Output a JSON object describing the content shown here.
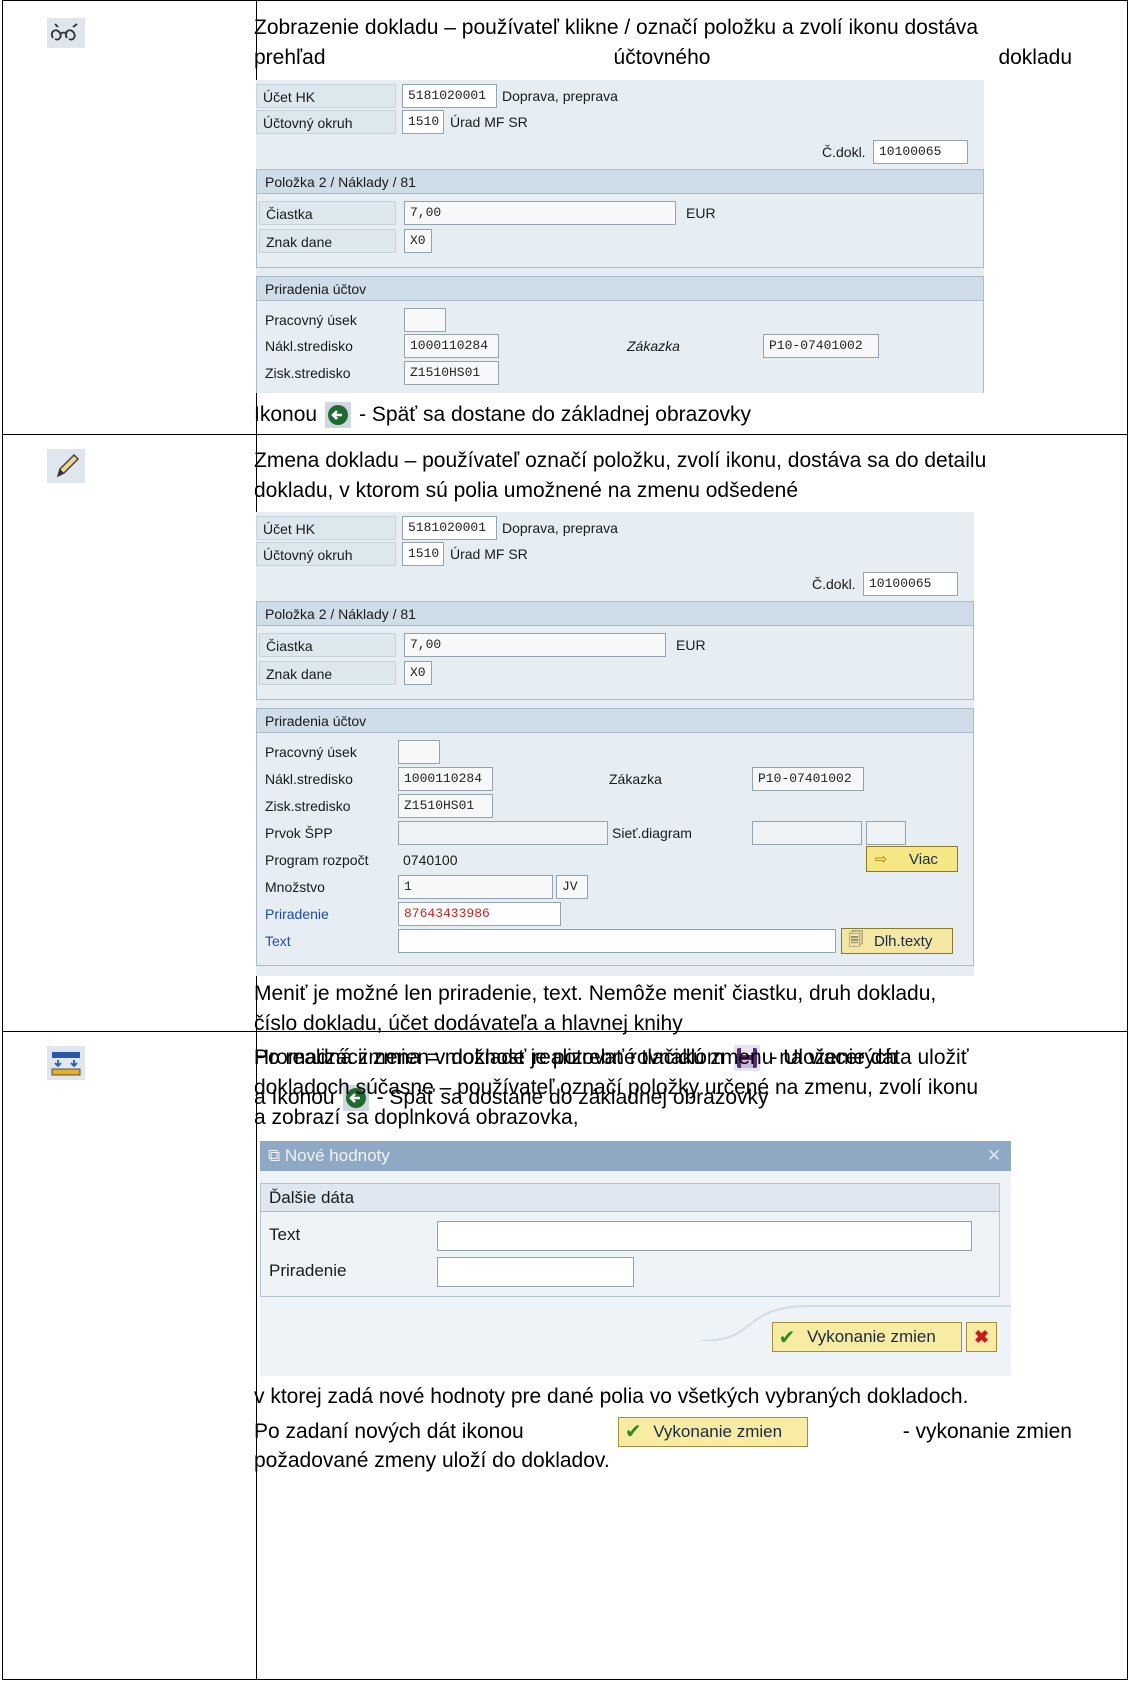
{
  "row1": {
    "icon": "glasses-icon",
    "desc_lines": [
      "Zobrazenie dokladu – používateľ klikne / označí položku a zvolí ikonu dostáva",
      "prehľad účtovného dokladu"
    ],
    "screen": {
      "ucet_hk_label": "Účet HK",
      "ucet_hk_value": "5181020001",
      "ucet_hk_desc": "Doprava, preprava",
      "okruh_label": "Účtovný okruh",
      "okruh_value": "1510",
      "okruh_desc": "Úrad MF SR",
      "cdokl_label": "Č.dokl.",
      "cdokl_value": "10100065",
      "polozka_title": "Položka 2 / Náklady / 81",
      "ciastka_label": "Čiastka",
      "ciastka_value": "7,00",
      "currency": "EUR",
      "znak_label": "Znak dane",
      "znak_value": "X0",
      "priradenia_title": "Priradenia účtov",
      "pracovny_label": "Pracovný úsek",
      "nakl_label": "Nákl.stredisko",
      "nakl_value": "1000110284",
      "zakazka_label": "Zákazka",
      "zakazka_value": "P10-07401002",
      "zisk_label": "Zisk.stredisko",
      "zisk_value": "Z1510HS01"
    },
    "footer_prefix": "Ikonou",
    "footer_suffix": "- Späť sa dostane do základnej obrazovky"
  },
  "row2": {
    "icon": "pencil-icon",
    "desc_lines": [
      "Zmena dokladu – používateľ označí položku, zvolí ikonu, dostáva sa do detailu",
      "dokladu, v ktorom sú polia umožnené na zmenu odšedené"
    ],
    "screen": {
      "ucet_hk_label": "Účet HK",
      "ucet_hk_value": "5181020001",
      "ucet_hk_desc": "Doprava, preprava",
      "okruh_label": "Účtovný okruh",
      "okruh_value": "1510",
      "okruh_desc": "Úrad MF SR",
      "cdokl_label": "Č.dokl.",
      "cdokl_value": "10100065",
      "polozka_title": "Položka 2 / Náklady / 81",
      "ciastka_label": "Čiastka",
      "ciastka_value": "7,00",
      "currency": "EUR",
      "znak_label": "Znak dane",
      "znak_value": "X0",
      "priradenia_title": "Priradenia účtov",
      "pracovny_label": "Pracovný úsek",
      "nakl_label": "Nákl.stredisko",
      "nakl_value": "1000110284",
      "zakazka_label": "Zákazka",
      "zakazka_value": "P10-07401002",
      "zisk_label": "Zisk.stredisko",
      "zisk_value": "Z1510HS01",
      "prvok_label": "Prvok ŠPP",
      "siet_label": "Sieť.diagram",
      "program_label": "Program rozpočt",
      "program_value": "0740100",
      "viac_label": "Viac",
      "mnozstvo_label": "Množstvo",
      "mnozstvo_value": "1",
      "unit_value": "JV",
      "priradenie_label": "Priradenie",
      "priradenie_value": "87643433986",
      "text_label": "Text",
      "dlh_label": "Dlh.texty"
    },
    "para1_lines": [
      "Meniť je možné len priradenie, text. Nemôže meniť čiastku, druh dokladu,",
      "číslo dokladu, účet dodávateľa a hlavnej knihy"
    ],
    "para2_prefix": "Po realizácii zmien v doklade je potrebné tlačidlom",
    "para2_suffix": "- Uloženie dáta uložiť",
    "para3_prefix": "a Ikonou",
    "para3_suffix": "- Späť sa dostane do základnej obrazovky"
  },
  "row3": {
    "icon": "mass-change-icon",
    "desc_lines": [
      "Hromadná zmena = možnosť realizovať rovnakú zmenu na viacerých",
      "dokladoch súčasne – používateľ označí položky určené na zmenu, zvolí ikonu",
      "a zobrazí sa doplnková obrazovka,"
    ],
    "dialog": {
      "title": "Nové hodnoty",
      "group_title": "Ďalšie dáta",
      "text_label": "Text",
      "priradenie_label": "Priradenie",
      "execute_label": "Vykonanie zmien"
    },
    "para1": "v ktorej zadá nové hodnoty pre dané polia vo všetkých vybraných dokladoch.",
    "para2_prefix": "Po zadaní nových dát ikonou",
    "para2_suffix": "- vykonanie zmien",
    "para3": "požadované zmeny uloží do dokladov.",
    "execute_label": "Vykonanie zmien"
  },
  "colors": {
    "sap_bg": "#e7eef3",
    "header_bg": "#cfdde8",
    "dialog_title_bg": "#8fa9c4",
    "button_bg": "#f5e784",
    "accent_blue": "#1f49b5",
    "accent_red": "#d31d1d"
  }
}
